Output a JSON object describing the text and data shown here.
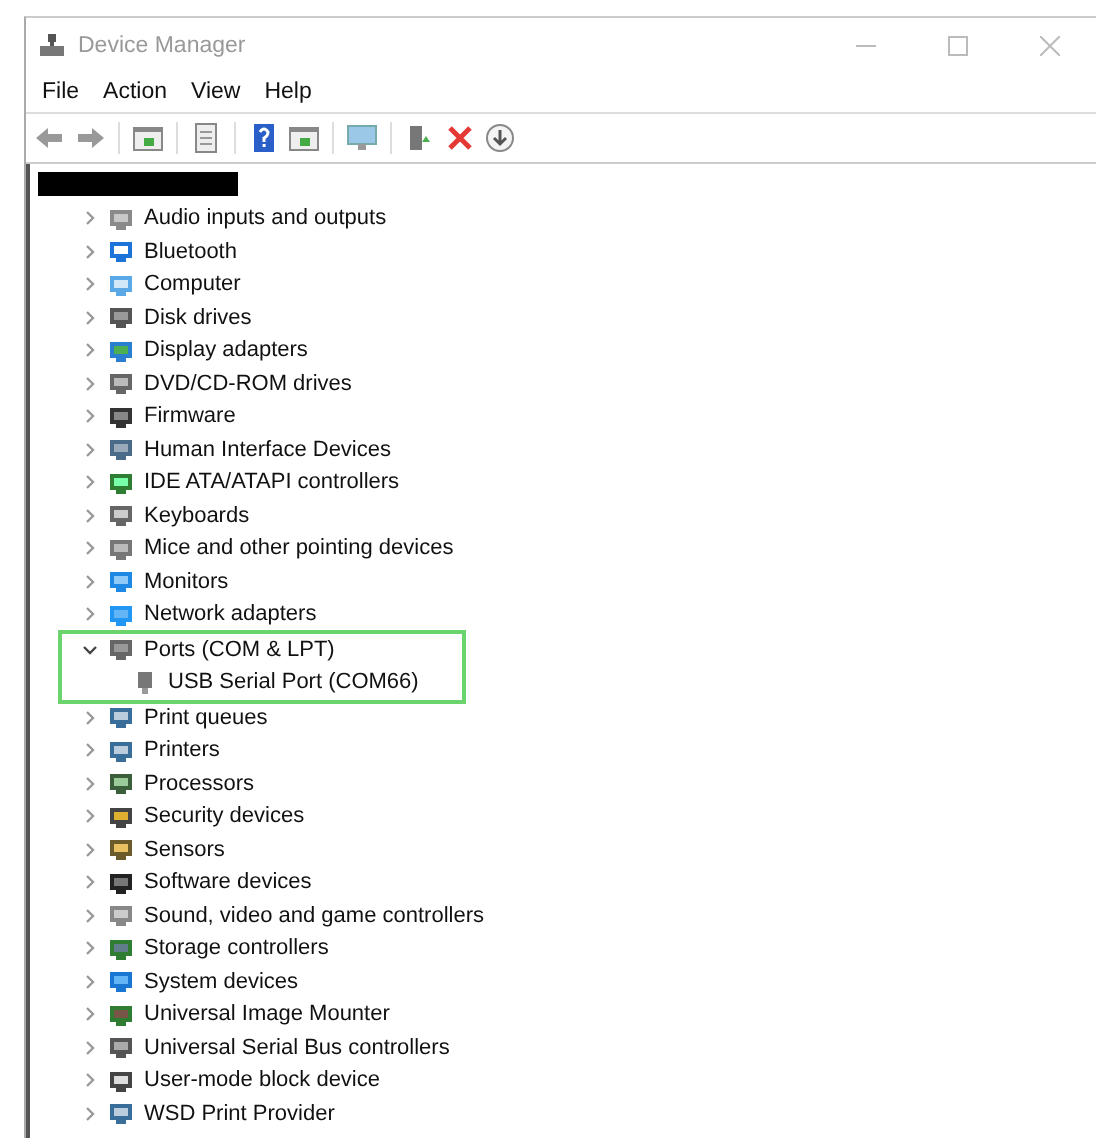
{
  "window": {
    "title": "Device Manager"
  },
  "menu": [
    "File",
    "Action",
    "View",
    "Help"
  ],
  "tree": {
    "items": [
      {
        "label": "Audio inputs and outputs",
        "expanded": false
      },
      {
        "label": "Bluetooth",
        "expanded": false
      },
      {
        "label": "Computer",
        "expanded": false
      },
      {
        "label": "Disk drives",
        "expanded": false
      },
      {
        "label": "Display adapters",
        "expanded": false
      },
      {
        "label": "DVD/CD-ROM drives",
        "expanded": false
      },
      {
        "label": "Firmware",
        "expanded": false
      },
      {
        "label": "Human Interface Devices",
        "expanded": false
      },
      {
        "label": "IDE ATA/ATAPI controllers",
        "expanded": false
      },
      {
        "label": "Keyboards",
        "expanded": false
      },
      {
        "label": "Mice and other pointing devices",
        "expanded": false
      },
      {
        "label": "Monitors",
        "expanded": false
      },
      {
        "label": "Network adapters",
        "expanded": false
      },
      {
        "label": "Ports (COM & LPT)",
        "expanded": true,
        "highlighted": true,
        "children": [
          {
            "label": "USB Serial Port (COM66)"
          }
        ]
      },
      {
        "label": "Print queues",
        "expanded": false
      },
      {
        "label": "Printers",
        "expanded": false
      },
      {
        "label": "Processors",
        "expanded": false
      },
      {
        "label": "Security devices",
        "expanded": false
      },
      {
        "label": "Sensors",
        "expanded": false
      },
      {
        "label": "Software devices",
        "expanded": false
      },
      {
        "label": "Sound, video and game controllers",
        "expanded": false
      },
      {
        "label": "Storage controllers",
        "expanded": false
      },
      {
        "label": "System devices",
        "expanded": false
      },
      {
        "label": "Universal Image Mounter",
        "expanded": false
      },
      {
        "label": "Universal Serial Bus controllers",
        "expanded": false
      },
      {
        "label": "User-mode block device",
        "expanded": false
      },
      {
        "label": "WSD Print Provider",
        "expanded": false
      }
    ]
  }
}
